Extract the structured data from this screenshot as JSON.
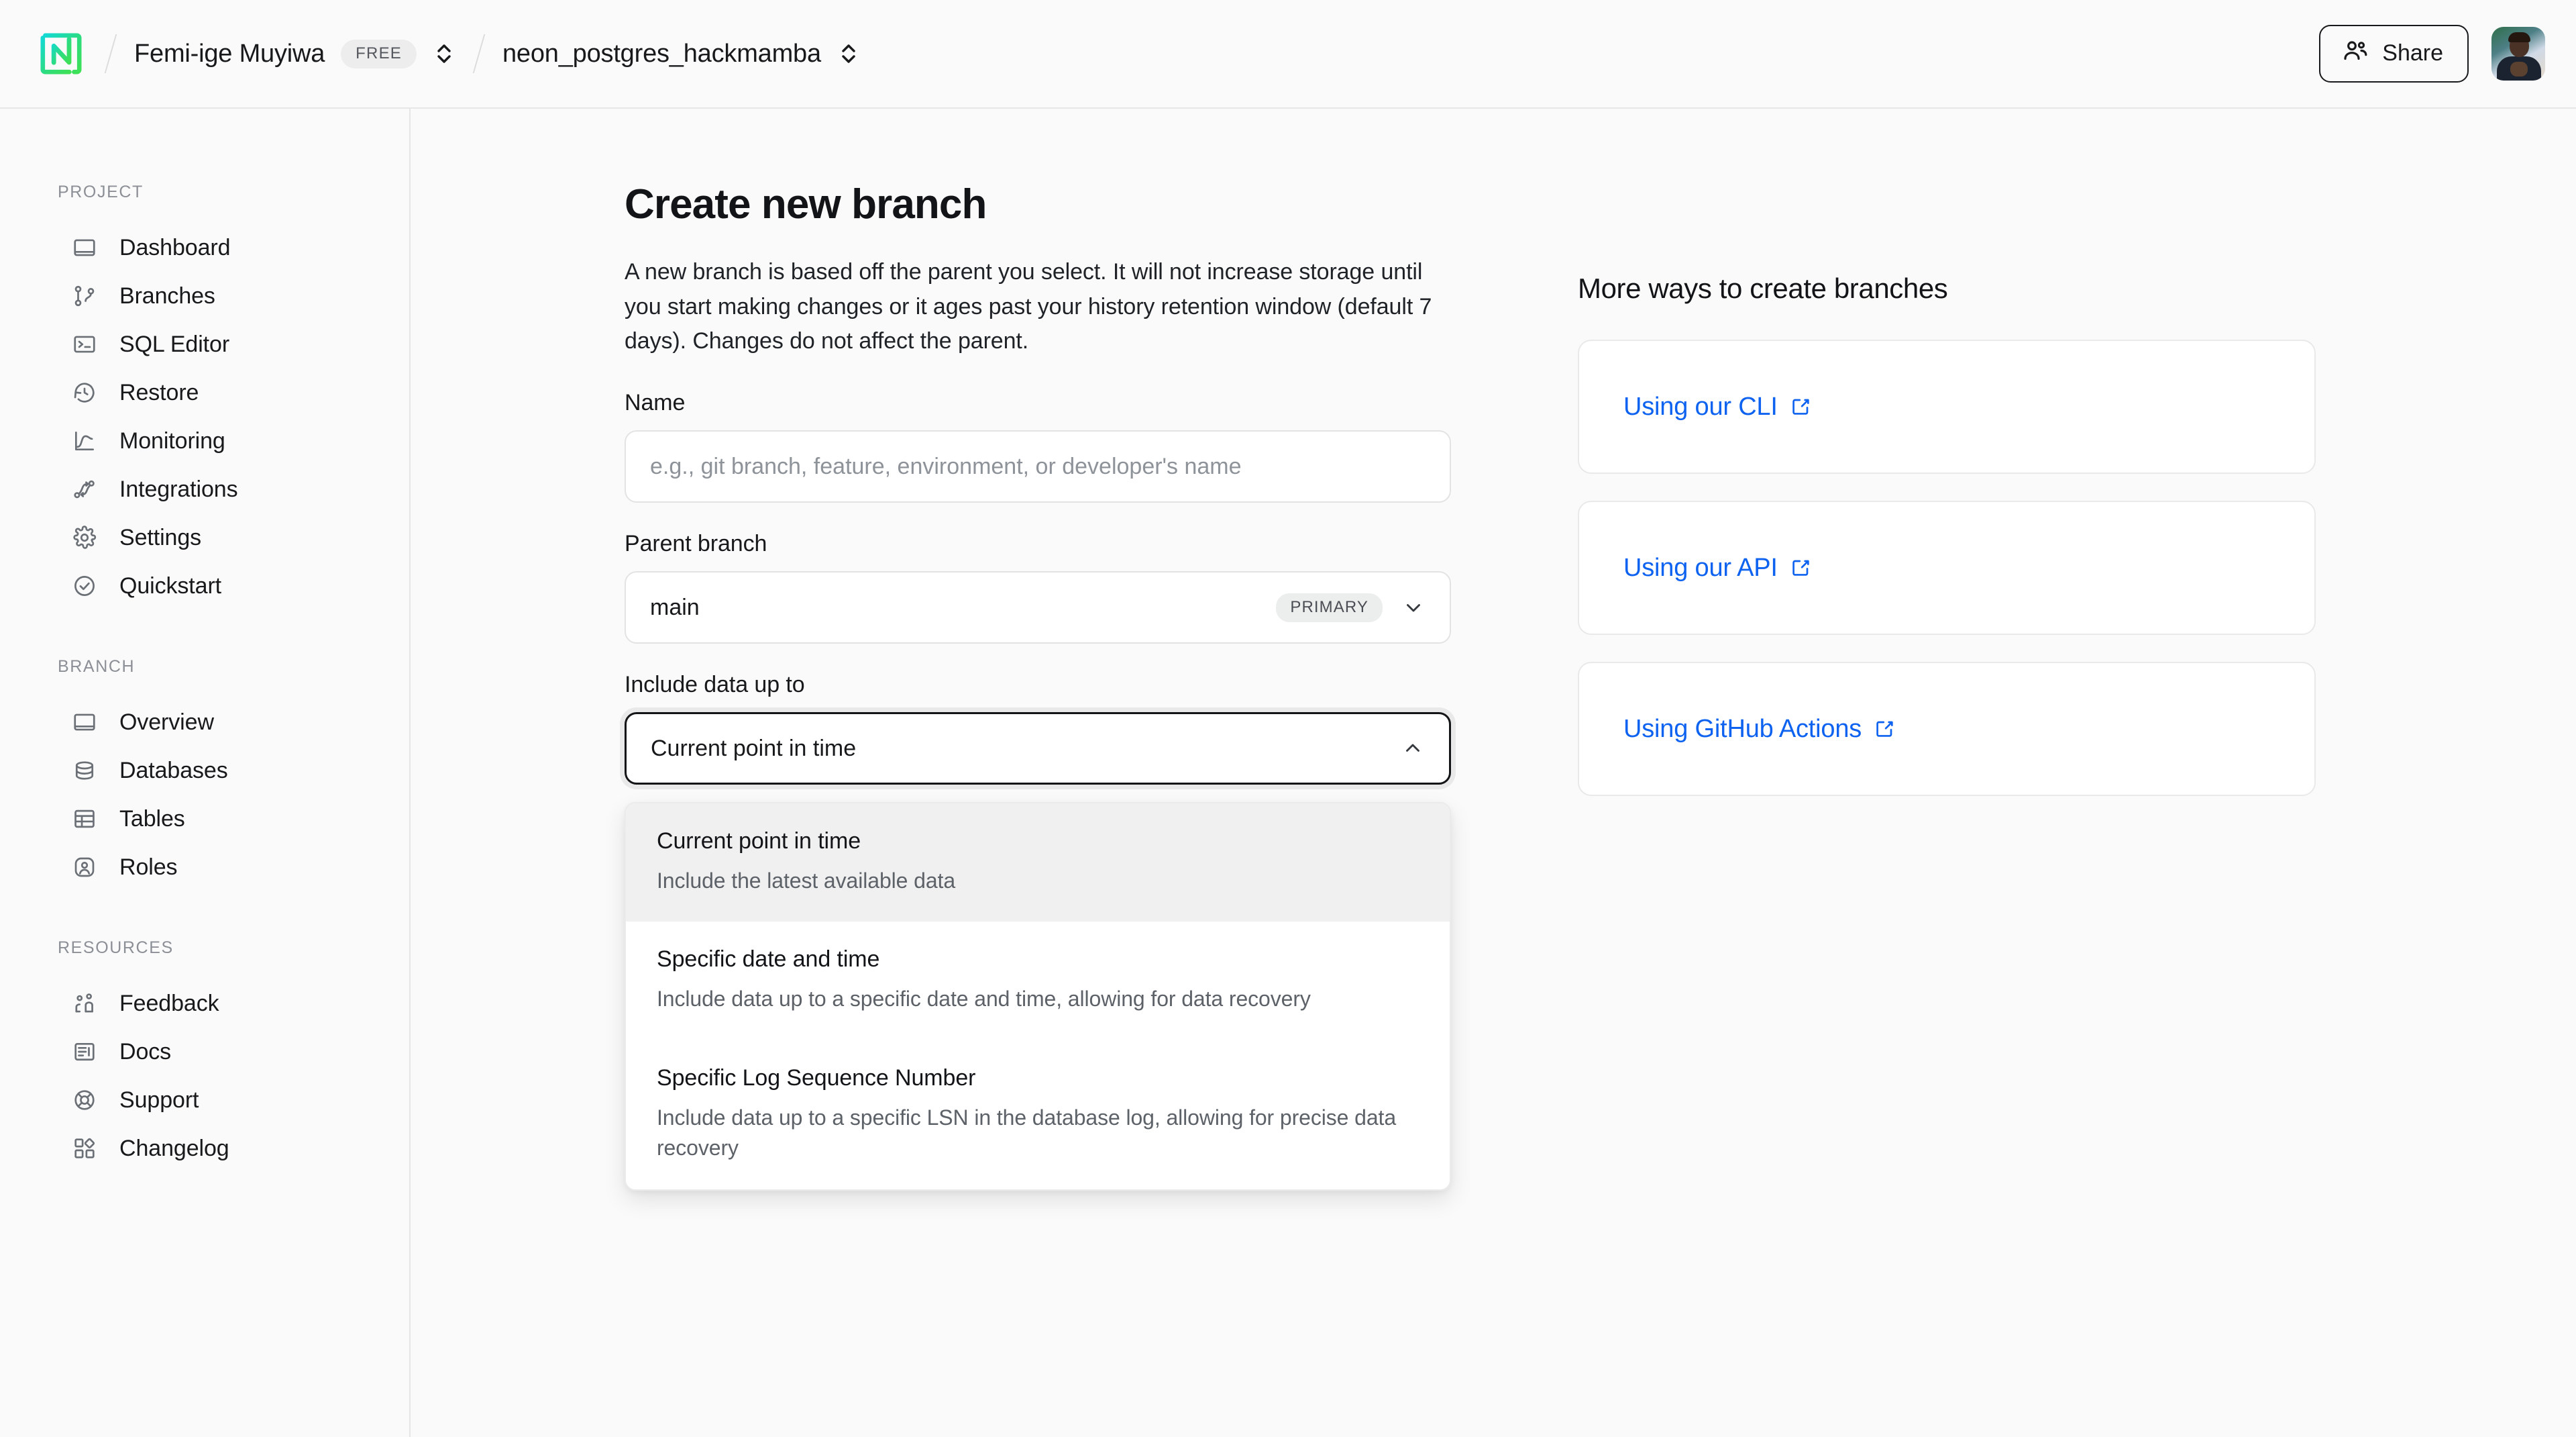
{
  "header": {
    "logo_name": "neon-logo",
    "breadcrumb": {
      "org_name": "Femi-ige Muyiwa",
      "org_plan_badge": "FREE",
      "project_name": "neon_postgres_hackmamba"
    },
    "share_label": "Share",
    "avatar_name": "user-avatar"
  },
  "sidebar": {
    "groups": [
      {
        "title": "PROJECT",
        "items": [
          {
            "label": "Dashboard",
            "icon": "dashboard-icon"
          },
          {
            "label": "Branches",
            "icon": "branches-icon"
          },
          {
            "label": "SQL Editor",
            "icon": "sql-editor-icon"
          },
          {
            "label": "Restore",
            "icon": "restore-icon"
          },
          {
            "label": "Monitoring",
            "icon": "monitoring-icon"
          },
          {
            "label": "Integrations",
            "icon": "integrations-icon"
          },
          {
            "label": "Settings",
            "icon": "gear-icon"
          },
          {
            "label": "Quickstart",
            "icon": "check-circle-icon"
          }
        ]
      },
      {
        "title": "BRANCH",
        "items": [
          {
            "label": "Overview",
            "icon": "overview-icon"
          },
          {
            "label": "Databases",
            "icon": "database-icon"
          },
          {
            "label": "Tables",
            "icon": "table-icon"
          },
          {
            "label": "Roles",
            "icon": "roles-shield-icon"
          }
        ]
      },
      {
        "title": "RESOURCES",
        "items": [
          {
            "label": "Feedback",
            "icon": "feedback-people-icon"
          },
          {
            "label": "Docs",
            "icon": "docs-icon"
          },
          {
            "label": "Support",
            "icon": "lifebuoy-icon"
          },
          {
            "label": "Changelog",
            "icon": "changelog-blocks-icon"
          }
        ]
      }
    ]
  },
  "main": {
    "title": "Create new branch",
    "description": "A new branch is based off the parent you select. It will not increase storage until you start making changes or it ages past your history retention window (default 7 days). Changes do not affect the parent.",
    "name_field": {
      "label": "Name",
      "value": "",
      "placeholder": "e.g., git branch, feature, environment, or developer's name"
    },
    "parent_branch_field": {
      "label": "Parent branch",
      "value": "main",
      "badge": "PRIMARY"
    },
    "include_data_field": {
      "label": "Include data up to",
      "value": "Current point in time",
      "expanded": true,
      "options": [
        {
          "title": "Current point in time",
          "description": "Include the latest available data",
          "selected": true
        },
        {
          "title": "Specific date and time",
          "description": "Include data up to a specific date and time, allowing for data recovery",
          "selected": false
        },
        {
          "title": "Specific Log Sequence Number",
          "description": "Include data up to a specific LSN in the database log, allowing for precise data recovery",
          "selected": false
        }
      ]
    }
  },
  "more_ways": {
    "heading": "More ways to create branches",
    "links": [
      {
        "label": "Using our CLI"
      },
      {
        "label": "Using our API"
      },
      {
        "label": "Using GitHub Actions"
      }
    ]
  },
  "colors": {
    "link": "#0e62f0",
    "brand_start": "#15d8cd",
    "brand_end": "#39e05a",
    "page_bg": "#fafafa",
    "border": "#e6e6e6"
  }
}
